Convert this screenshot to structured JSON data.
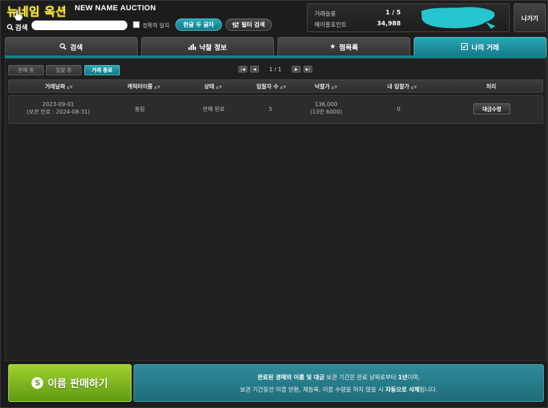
{
  "header": {
    "logo": "뉴네임 옥션",
    "subtitle": "NEW NAME AUCTION",
    "search_label": "검색",
    "search_value": "",
    "exact_match_label": "정확히 일치",
    "hangul_button": "한글 두 글자",
    "filter_button": "필터 검색",
    "exit_button": "나가기"
  },
  "stats": {
    "slot_label": "거래슬롯",
    "slot_value": "1 / 5",
    "points_label": "메이플포인트",
    "points_value": "34,988"
  },
  "tabs": [
    {
      "label": "검색",
      "icon": "search-icon",
      "active": false
    },
    {
      "label": "낙찰 정보",
      "icon": "bar-chart-icon",
      "active": false
    },
    {
      "label": "찜목록",
      "icon": "star-icon",
      "active": false
    },
    {
      "label": "나의 거래",
      "icon": "checkbox-icon",
      "active": true
    }
  ],
  "sub_tabs": [
    {
      "label": "판매 중",
      "active": false
    },
    {
      "label": "입찰 중",
      "active": false
    },
    {
      "label": "거래 종료",
      "active": true
    }
  ],
  "pager": {
    "text": "1 / 1",
    "first": "|◀",
    "prev": "◀",
    "next": "▶",
    "last": "▶|"
  },
  "table": {
    "columns": [
      "거래날짜",
      "캐릭터이름",
      "상태",
      "입찰자 수",
      "낙찰가",
      "내 입찰가",
      "처리"
    ],
    "rows": [
      {
        "date": "2023-09-01",
        "storage_until": "(보관 만료 : 2024-08-31)",
        "character": "홍림",
        "status": "판매 완료",
        "bidders": "5",
        "price": "136,000",
        "price_kr": "(13만 6000)",
        "my_bid": "0",
        "action": "대금수령"
      }
    ]
  },
  "bottom": {
    "sell_button": "이름 판매하기",
    "sell_icon_glyph": "S",
    "notice_line1_pre": "완료된 경매의 이름 및 대금",
    "notice_line1_mid": " 보관 기간은 완료 날짜로부터 ",
    "notice_line1_bold": "1년",
    "notice_line1_post": "이며,",
    "notice_line2_pre": "보관 기간동안 이름 반환, 재등록, 이름 수령을 하지 않을 시 ",
    "notice_line2_bold": "자동으로 삭제",
    "notice_line2_post": "됩니다."
  },
  "colors": {
    "accent_teal": "#1f8d9a",
    "accent_green": "#8cc21f",
    "logo_yellow": "#ffe94a",
    "redaction": "#27c6cf"
  }
}
